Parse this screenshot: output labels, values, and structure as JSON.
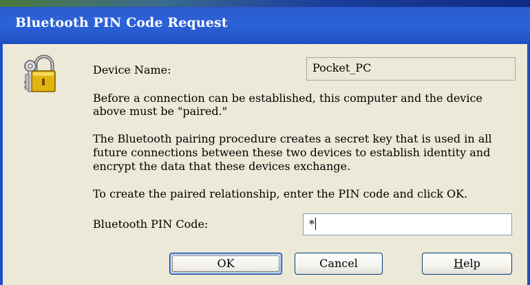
{
  "window": {
    "title": "Bluetooth PIN Code Request"
  },
  "icons": {
    "dialog_icon": "keys-lock-icon"
  },
  "device": {
    "label": "Device Name:",
    "value": "Pocket_PC"
  },
  "paragraphs": {
    "p1_line1": "Before a connection can be established, this computer and the device",
    "p1_line2": "above must be \"paired.\"",
    "p2_line1": "The Bluetooth pairing procedure creates a secret key that is used in all",
    "p2_line2": "future connections between these two devices to establish identity and",
    "p2_line3": "encrypt the data that these devices exchange.",
    "p3_line1": "To create the paired relationship, enter the PIN code and click OK."
  },
  "pin": {
    "label": "Bluetooth PIN Code:",
    "value": "*"
  },
  "buttons": {
    "ok": "OK",
    "cancel": "Cancel",
    "help_first": "H",
    "help_rest": "elp"
  },
  "colors": {
    "title_bar": "#2c62d8",
    "dialog_bg": "#ece9d8",
    "button_border": "#003c74"
  }
}
